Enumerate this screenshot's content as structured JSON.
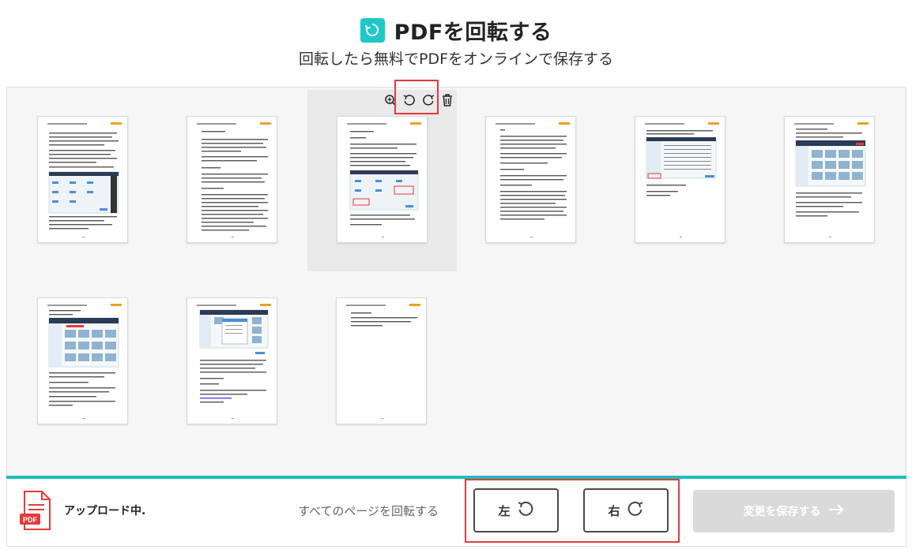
{
  "header": {
    "title": "PDFを回転する",
    "subtitle": "回転したら無料でPDFをオンラインで保存する",
    "icon": "rotate-icon"
  },
  "pages": [
    {
      "kind": "text-image"
    },
    {
      "kind": "text"
    },
    {
      "kind": "text-image",
      "selected": true
    },
    {
      "kind": "text"
    },
    {
      "kind": "table"
    },
    {
      "kind": "gallery"
    },
    {
      "kind": "gallery"
    },
    {
      "kind": "screenshot"
    },
    {
      "kind": "sparse"
    }
  ],
  "page_tools": [
    "zoom-in-icon",
    "rotate-left-icon",
    "rotate-right-icon",
    "trash-icon"
  ],
  "footer": {
    "status": "アップロード中.",
    "rotate_all_label": "すべてのページを回転する",
    "left_label": "左",
    "right_label": "右",
    "save_label": "変更を保存する",
    "file_badge": "PDF"
  },
  "colors": {
    "accent": "#1ebdbd",
    "highlight": "#e53a3a",
    "disabled": "#dadada"
  }
}
